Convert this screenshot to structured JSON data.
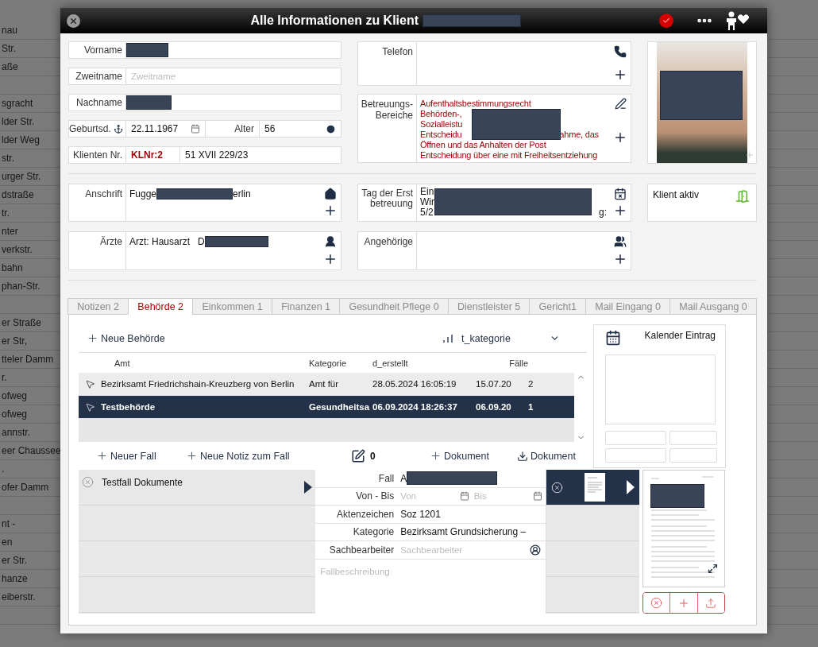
{
  "background": {
    "rows": [
      {
        "text": "nau"
      },
      {
        "text": "Str."
      },
      {
        "text": "aße"
      },
      {},
      {
        "text": "sgracht"
      },
      {
        "text": "lder Str."
      },
      {
        "text": "lder Weg"
      },
      {
        "text": "str."
      },
      {
        "text": "urger Str."
      },
      {
        "text": "dstraße"
      },
      {
        "text": "tr."
      },
      {
        "text": "nter"
      },
      {
        "text": "verkstr."
      },
      {
        "text": "bahn"
      },
      {
        "text": "phan-Str."
      },
      {},
      {
        "text": "er Straße"
      },
      {
        "text": "er Str,"
      },
      {
        "text": "tteler Damm"
      },
      {
        "text": "r."
      },
      {
        "text": "ofweg"
      },
      {
        "text": "ofweg"
      },
      {
        "text": "annstr."
      },
      {
        "text": "eer Chaussee"
      },
      {
        "text": "."
      },
      {
        "text": "ofer Damm"
      },
      {},
      {
        "text": "nt -"
      },
      {
        "text": "en"
      },
      {
        "text": "er Str."
      },
      {
        "text": "hanze"
      },
      {
        "text": "eiberstr."
      },
      {}
    ]
  },
  "dialog": {
    "title": "Alle Informationen zu Klient",
    "personal": {
      "first_name": {
        "label": "Vorname"
      },
      "middle_name": {
        "label": "Zweitname",
        "placeholder": "Zweitname"
      },
      "last_name": {
        "label": "Nachname"
      },
      "birth": {
        "label": "Geburtsd.",
        "value": "22.11.1967"
      },
      "age": {
        "label": "Alter",
        "value": "56"
      },
      "client_no": {
        "label": "Klienten Nr.",
        "code": "KLNr:2",
        "value": "51 XVII 229/23"
      }
    },
    "phone": {
      "label": "Telefon"
    },
    "care_areas": {
      "label": "Betreuungs-Bereiche",
      "lines": [
        {
          "text": "Aufenthaltsbestimmungsrecht"
        },
        {
          "kind": "clipped",
          "text": "Behörden-,"
        },
        {
          "kind": "clipped",
          "text": "Sozialleistu"
        },
        {
          "kind": "clipped",
          "text": "Entscheidu",
          "tail": "ahme, das"
        },
        {
          "text": "Öffnen und das Anhalten der Post"
        },
        {
          "text": "Entscheidung über eine mit Freiheitsentziehung"
        }
      ]
    },
    "address": {
      "label": "Anschrift",
      "value_start": "Fugge",
      "value_end": "erlin"
    },
    "first_care": {
      "label": "Tag der Erstbetreuung",
      "lines": [
        "Ein",
        "Wir",
        "5/2"
      ],
      "line_end": "g:"
    },
    "status": {
      "label": "Klient aktiv"
    },
    "doctors": {
      "label": "Ärzte",
      "value": "Arzt: Hausarzt   D"
    },
    "relatives": {
      "label": "Angehörige"
    },
    "tabs": [
      {
        "label": "Notizen 2",
        "selected": false
      },
      {
        "label": "Behörde 2",
        "selected": true
      },
      {
        "label": "Einkommen 1",
        "selected": false
      },
      {
        "label": "Finanzen 1",
        "selected": false
      },
      {
        "label": "Gesundheit Pflege 0",
        "selected": false
      },
      {
        "label": "Dienstleister 5",
        "selected": false
      },
      {
        "label": "Gericht1",
        "selected": false
      },
      {
        "label": "Mail Eingang 0",
        "selected": false
      },
      {
        "label": "Mail Ausgang 0",
        "selected": false
      }
    ],
    "authorities": {
      "add": "Neue Behörde",
      "sort": "t_kategorie",
      "columns": [
        "Amt",
        "Kategorie",
        "d_erstellt",
        "Fälle"
      ],
      "rows": [
        {
          "name": "Bezirksamt Friedrichshain-Kreuzberg von Berlin",
          "category": "Amt für",
          "created": "28.05.2024 16:05:19",
          "date": "15.07.20",
          "cases": "2",
          "selected": false
        },
        {
          "name": "Testbehörde",
          "category": "Gesundheitsa",
          "created": "06.09.2024 18:26:37",
          "date": "06.09.20",
          "cases": "1",
          "selected": true
        }
      ]
    },
    "calendar": {
      "label": "Kalender Eintrag"
    },
    "case_toolbar": {
      "new_case": "Neuer Fall",
      "new_note": "Neue Notiz zum Fall",
      "notes_count": "0",
      "add_document": "Dokument",
      "download_document": "Dokument"
    },
    "cases": [
      {
        "name": "Testfall Dokumente"
      }
    ],
    "case_form": {
      "fields": [
        {
          "kind": "text",
          "label": "Fall",
          "value": "A"
        },
        {
          "kind": "range",
          "label": "Von - Bis",
          "from_placeholder": "Von",
          "to_placeholder": "Bis"
        },
        {
          "kind": "text",
          "label": "Aktenzeichen",
          "value": "Soz 1201"
        },
        {
          "kind": "text",
          "label": "Kategorie",
          "value": "Bezirksamt Grundsicherung –"
        },
        {
          "kind": "person",
          "label": "Sachbearbeiter",
          "placeholder": "Sachbearbeiter"
        }
      ],
      "description_placeholder": "Fallbeschreibung"
    },
    "documents": [
      {
        "selected": true
      }
    ]
  }
}
